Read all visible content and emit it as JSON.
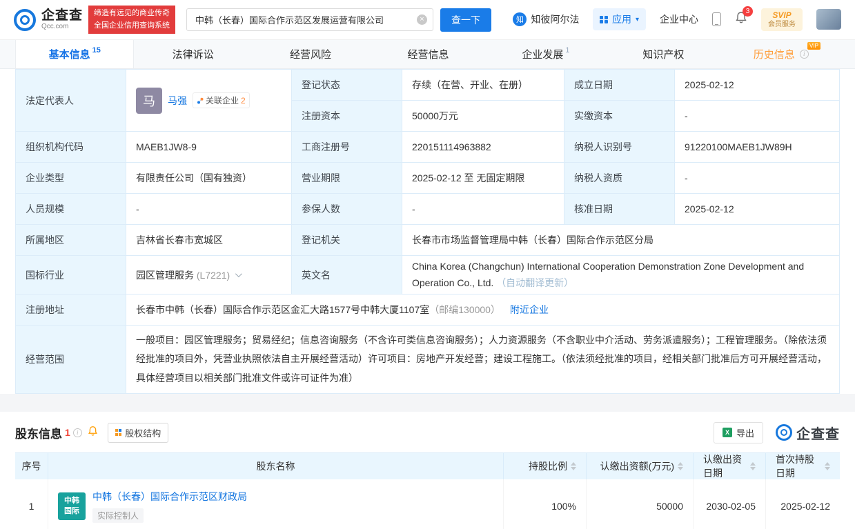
{
  "brand": {
    "name": "企查查",
    "sub": "Qcc.com",
    "slogan1": "缔造有远见的商业传奇",
    "slogan2": "全国企业信用查询系统"
  },
  "search": {
    "value": "中韩（长春）国际合作示范区发展运营有限公司",
    "button": "查一下"
  },
  "topnav": {
    "zhibi": "知彼阿尔法",
    "zhibi_icon": "知",
    "apps": "应用",
    "center": "企业中心",
    "badge": "3",
    "svip": "SVIP",
    "svip_sub": "会员服务"
  },
  "icons": {
    "clear": "×",
    "caret": "▾",
    "excel": "X"
  },
  "tabs": [
    {
      "label": "基本信息",
      "count": "15"
    },
    {
      "label": "法律诉讼"
    },
    {
      "label": "经营风险"
    },
    {
      "label": "经营信息"
    },
    {
      "label": "企业发展",
      "count": "1"
    },
    {
      "label": "知识产权"
    },
    {
      "label": "历史信息",
      "vip": "VIP"
    }
  ],
  "basic": {
    "legal_rep": {
      "label": "法定代表人",
      "avatar": "马",
      "name": "马强",
      "related": "关联企业",
      "related_count": "2"
    },
    "reg_status": {
      "label": "登记状态",
      "value": "存续（在营、开业、在册）"
    },
    "establish_date": {
      "label": "成立日期",
      "value": "2025-02-12"
    },
    "reg_capital": {
      "label": "注册资本",
      "value": "50000万元"
    },
    "paid_capital": {
      "label": "实缴资本",
      "value": "-"
    },
    "org_code": {
      "label": "组织机构代码",
      "value": "MAEB1JW8-9"
    },
    "reg_no": {
      "label": "工商注册号",
      "value": "220151114963882"
    },
    "tax_id": {
      "label": "纳税人识别号",
      "value": "91220100MAEB1JW89H"
    },
    "company_type": {
      "label": "企业类型",
      "value": "有限责任公司（国有独资）"
    },
    "term": {
      "label": "营业期限",
      "value": "2025-02-12 至 无固定期限"
    },
    "tax_quality": {
      "label": "纳税人资质",
      "value": "-"
    },
    "staff": {
      "label": "人员规模",
      "value": "-"
    },
    "insured": {
      "label": "参保人数",
      "value": "-"
    },
    "approval": {
      "label": "核准日期",
      "value": "2025-02-12"
    },
    "region": {
      "label": "所属地区",
      "value": "吉林省长春市宽城区"
    },
    "authority": {
      "label": "登记机关",
      "value": "长春市市场监督管理局中韩（长春）国际合作示范区分局"
    },
    "industry": {
      "label": "国标行业",
      "value": "园区管理服务",
      "code": "(L7221)"
    },
    "english": {
      "label": "英文名",
      "value": "China Korea (Changchun) International Cooperation Demonstration Zone Development and Operation Co., Ltd.",
      "note": "（自动翻译更新）"
    },
    "address": {
      "label": "注册地址",
      "value": "长春市中韩（长春）国际合作示范区金汇大路1577号中韩大厦1107室",
      "post": "（邮编130000）",
      "nearby": "附近企业"
    },
    "scope": {
      "label": "经营范围",
      "value": "一般项目：园区管理服务；贸易经纪；信息咨询服务（不含许可类信息咨询服务）；人力资源服务（不含职业中介活动、劳务派遣服务）；工程管理服务。（除依法须经批准的项目外，凭营业执照依法自主开展经营活动）许可项目：房地产开发经营；建设工程施工。（依法须经批准的项目，经相关部门批准后方可开展经营活动，具体经营项目以相关部门批准文件或许可证件为准）"
    }
  },
  "shareholders": {
    "title": "股东信息",
    "count": "1",
    "equity": "股权结构",
    "export": "导出",
    "logo": "企查查",
    "columns": {
      "no": "序号",
      "name": "股东名称",
      "ratio": "持股比例",
      "amount": "认缴出资额(万元)",
      "date": "认缴出资日期",
      "first": "首次持股日期"
    },
    "rows": [
      {
        "no": "1",
        "logo1": "中韩",
        "logo2": "国际",
        "name": "中韩（长春）国际合作示范区财政局",
        "badge": "实际控制人",
        "ratio": "100%",
        "amount": "50000",
        "date": "2030-02-05",
        "first": "2025-02-12"
      }
    ]
  }
}
